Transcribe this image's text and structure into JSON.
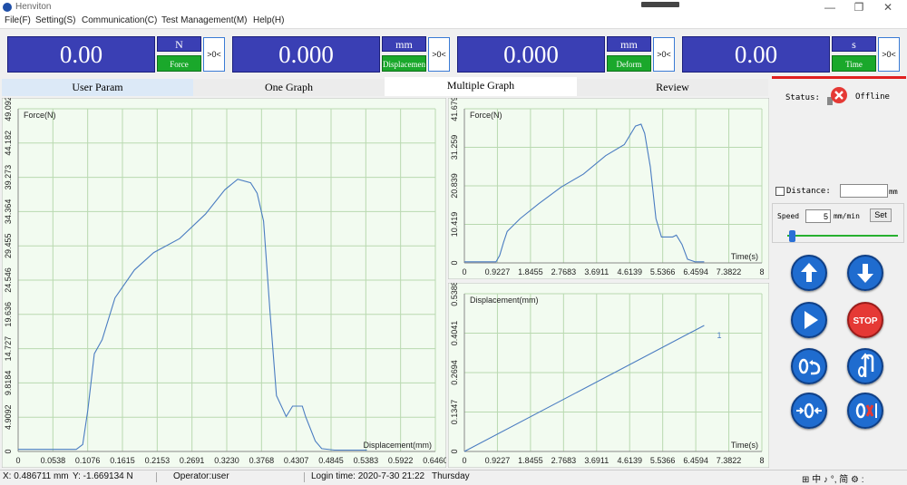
{
  "app": {
    "title": "Henviton"
  },
  "window_controls": {
    "minimize": "—",
    "maximize": "❐",
    "close": "✕"
  },
  "menu": [
    "File(F)",
    "Setting(S)",
    "Communication(C)",
    "Test Management(M)",
    "Help(H)"
  ],
  "readouts": [
    {
      "value": "0.00",
      "unit": "N",
      "name": "Force",
      "zero": ">0<"
    },
    {
      "value": "0.000",
      "unit": "mm",
      "name": "Displacement",
      "zero": ">0<"
    },
    {
      "value": "0.000",
      "unit": "mm",
      "name": "Deform",
      "zero": ">0<"
    },
    {
      "value": "0.00",
      "unit": "s",
      "name": "Time",
      "zero": ">0<"
    }
  ],
  "tabs": [
    {
      "label": "User Param",
      "active": false
    },
    {
      "label": "One Graph",
      "active": false
    },
    {
      "label": "Multiple Graph",
      "active": true
    },
    {
      "label": "Review",
      "active": false
    }
  ],
  "status": {
    "label": "Status:",
    "value": "Offline"
  },
  "distance": {
    "label": "Distance:",
    "value": "",
    "unit": "mm",
    "checked": false
  },
  "speed": {
    "label": "Speed",
    "value": "5",
    "unit": "mm/min",
    "set_label": "Set",
    "slider_fraction": 0.02
  },
  "controls": {
    "up": "up",
    "down": "down",
    "start": "start",
    "stop": "STOP",
    "return": "return",
    "reverse": "reverse",
    "zero": "zero",
    "clear": "clear"
  },
  "statusbar": {
    "x": "X: 0.486711 mm",
    "y": "Y: -1.669134 N",
    "operator": "Operator:user",
    "login": "Login time:  2020-7-30 21:22",
    "day": "Thursday",
    "ime": "⊞ 中 ♪ °, 简 ⚙ :"
  },
  "colors": {
    "readout_blue": "#3a3fb4",
    "name_green": "#1aa82b",
    "plot_bg": "#f2fbf0",
    "grid": "#b9d9b0",
    "line": "#4a7cc1",
    "status_red": "#e02020"
  },
  "chart_data": [
    {
      "type": "line",
      "title": "",
      "xlabel": "Displacement(mm)",
      "ylabel": "Force(N)",
      "xlim": [
        0,
        0.646
      ],
      "ylim": [
        0,
        49.092
      ],
      "xticks": [
        "0",
        "0.0538",
        "0.1076",
        "0.1615",
        "0.2153",
        "0.2691",
        "0.3230",
        "0.3768",
        "0.4307",
        "0.4845",
        "0.5383",
        "0.5922",
        "0.6460"
      ],
      "yticks": [
        "0",
        "4.9092",
        "9.8184",
        "14.727",
        "19.636",
        "24.546",
        "29.455",
        "34.364",
        "39.273",
        "44.182",
        "49.092"
      ],
      "x": [
        0,
        0.09,
        0.1,
        0.108,
        0.118,
        0.13,
        0.15,
        0.18,
        0.21,
        0.25,
        0.29,
        0.32,
        0.34,
        0.36,
        0.37,
        0.38,
        0.39,
        0.4,
        0.41,
        0.415,
        0.425,
        0.44,
        0.445,
        0.46,
        0.47,
        0.49,
        0.54
      ],
      "y": [
        0.3,
        0.3,
        1,
        6,
        14,
        16,
        22,
        26,
        28.5,
        30.5,
        34,
        37.5,
        39,
        38.5,
        37,
        33,
        20,
        8,
        6,
        5,
        6.5,
        6.5,
        5,
        1.5,
        0.4,
        0.2,
        0.2
      ]
    },
    {
      "type": "line",
      "title": "",
      "xlabel": "Time(s)",
      "ylabel": "Force(N)",
      "xlim": [
        0,
        8
      ],
      "ylim": [
        0,
        41.679
      ],
      "xticks": [
        "0",
        "0.9227",
        "1.8455",
        "2.7683",
        "3.6911",
        "4.6139",
        "5.5366",
        "6.4594",
        "7.3822",
        "8"
      ],
      "yticks": [
        "0",
        "10.419",
        "20.839",
        "31.259",
        "41.679"
      ],
      "x": [
        0,
        0.85,
        0.95,
        1.05,
        1.15,
        1.5,
        2.0,
        2.6,
        3.2,
        3.8,
        4.3,
        4.6,
        4.75,
        4.85,
        5.0,
        5.15,
        5.3,
        5.6,
        5.7,
        5.85,
        6.0,
        6.2,
        6.45
      ],
      "y": [
        0.3,
        0.3,
        2,
        5.5,
        8.5,
        12,
        16,
        20.5,
        24,
        29,
        32,
        37,
        37.5,
        35,
        26,
        12,
        7,
        7,
        7.5,
        5,
        1,
        0.3,
        0.3
      ]
    },
    {
      "type": "line",
      "title": "",
      "xlabel": "Time(s)",
      "ylabel": "Displacement(mm)",
      "xlim": [
        0,
        8
      ],
      "ylim": [
        0,
        0.6735
      ],
      "xticks": [
        "0",
        "0.9227",
        "1.8455",
        "2.7683",
        "3.6911",
        "4.6139",
        "5.5366",
        "6.4594",
        "7.3822",
        "8"
      ],
      "yticks": [
        "0",
        "0.1347",
        "0.2694",
        "0.4041",
        "0.5388"
      ],
      "x": [
        0,
        6.45
      ],
      "y": [
        0,
        0.538
      ],
      "annotation": "1"
    }
  ]
}
